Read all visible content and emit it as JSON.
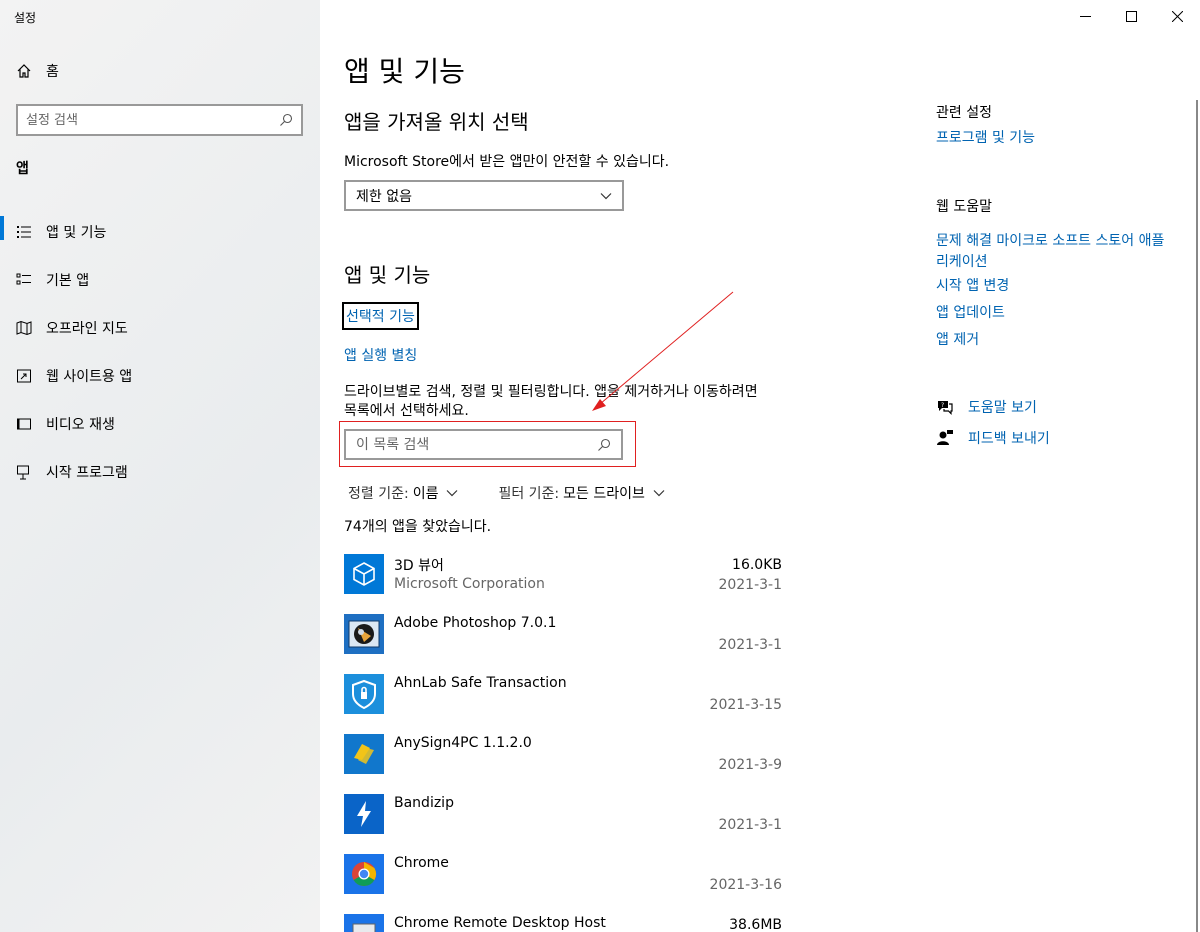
{
  "window": {
    "title": "설정"
  },
  "sidebar": {
    "home_label": "홈",
    "search_placeholder": "설정 검색",
    "section": "앱",
    "items": [
      {
        "label": "앱 및 기능",
        "icon": "list-icon",
        "active": true
      },
      {
        "label": "기본 앱",
        "icon": "list-check-icon",
        "active": false
      },
      {
        "label": "오프라인 지도",
        "icon": "map-icon",
        "active": false
      },
      {
        "label": "웹 사이트용 앱",
        "icon": "link-window-icon",
        "active": false
      },
      {
        "label": "비디오 재생",
        "icon": "video-icon",
        "active": false
      },
      {
        "label": "시작 프로그램",
        "icon": "startup-icon",
        "active": false
      }
    ]
  },
  "main": {
    "title": "앱 및 기능",
    "install_section": {
      "heading": "앱을 가져올 위치 선택",
      "description": "Microsoft Store에서 받은 앱만이 안전할 수 있습니다.",
      "dropdown_value": "제한 없음"
    },
    "apps_section": {
      "heading": "앱 및 기능",
      "optional_features": "선택적 기능",
      "app_aliases": "앱 실행 별칭",
      "description_line1": "드라이브별로 검색, 정렬 및 필터링합니다. 앱을 제거하거나 이동하려면",
      "description_line2": "목록에서 선택하세요.",
      "search_placeholder": "이 목록 검색",
      "sort_label": "정렬 기준:",
      "sort_value": "이름",
      "filter_label": "필터 기준:",
      "filter_value": "모든 드라이브",
      "count_text": "74개의 앱을 찾았습니다."
    },
    "apps": [
      {
        "name": "3D 뷰어",
        "publisher": "Microsoft Corporation",
        "size": "16.0KB",
        "date": "2021-3-1",
        "icon": "cube-icon"
      },
      {
        "name": "Adobe Photoshop 7.0.1",
        "publisher": "",
        "size": "",
        "date": "2021-3-1",
        "icon": "photoshop-icon"
      },
      {
        "name": "AhnLab Safe Transaction",
        "publisher": "",
        "size": "",
        "date": "2021-3-15",
        "icon": "shield-icon"
      },
      {
        "name": "AnySign4PC 1.1.2.0",
        "publisher": "",
        "size": "",
        "date": "2021-3-9",
        "icon": "anysign-icon"
      },
      {
        "name": "Bandizip",
        "publisher": "",
        "size": "",
        "date": "2021-3-1",
        "icon": "bandizip-icon"
      },
      {
        "name": "Chrome",
        "publisher": "",
        "size": "",
        "date": "2021-3-16",
        "icon": "chrome-icon"
      },
      {
        "name": "Chrome Remote Desktop Host",
        "publisher": "",
        "size": "38.6MB",
        "date": "",
        "icon": "remote-desktop-icon"
      }
    ]
  },
  "related": {
    "heading": "관련 설정",
    "programs_link": "프로그램 및 기능",
    "web_help_heading": "웹 도움말",
    "web_links": [
      "문제 해결 마이크로 소프트 스토어 애플 리케이션",
      "시작 앱 변경",
      "앱 업데이트",
      "앱 제거"
    ],
    "get_help": "도움말 보기",
    "feedback": "피드백 보내기"
  },
  "colors": {
    "accent": "#0078d7",
    "link": "#0063b1",
    "annotation": "#e02020"
  }
}
